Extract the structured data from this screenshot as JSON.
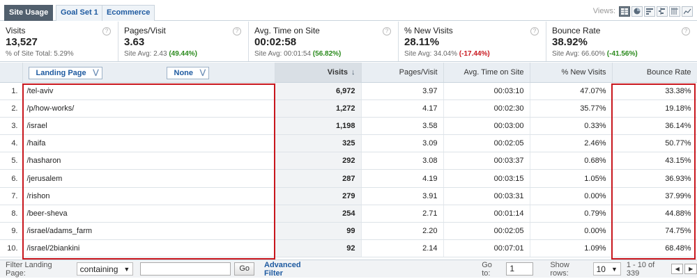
{
  "tabs": [
    {
      "label": "Site Usage",
      "active": true
    },
    {
      "label": "Goal Set 1",
      "active": false
    },
    {
      "label": "Ecommerce",
      "active": false
    }
  ],
  "views": {
    "label": "Views:",
    "icons": [
      "table-view-icon",
      "pie-view-icon",
      "performance-view-icon",
      "comparison-view-icon",
      "pivot-view-icon",
      "trend-view-icon"
    ]
  },
  "scorecard": [
    {
      "name": "Visits",
      "value": "13,527",
      "sub_prefix": "% of Site Total: ",
      "sub_value": "5.29%",
      "sub_delta": ""
    },
    {
      "name": "Pages/Visit",
      "value": "3.63",
      "sub_prefix": "Site Avg: ",
      "sub_value": "2.43",
      "sub_delta": "(49.44%)",
      "delta_type": "pos"
    },
    {
      "name": "Avg. Time on Site",
      "value": "00:02:58",
      "sub_prefix": "Site Avg: ",
      "sub_value": "00:01:54",
      "sub_delta": "(56.82%)",
      "delta_type": "pos"
    },
    {
      "name": "% New Visits",
      "value": "28.11%",
      "sub_prefix": "Site Avg: ",
      "sub_value": "34.04%",
      "sub_delta": "(-17.44%)",
      "delta_type": "neg"
    },
    {
      "name": "Bounce Rate",
      "value": "38.92%",
      "sub_prefix": "Site Avg: ",
      "sub_value": "66.60%",
      "sub_delta": "(-41.56%)",
      "delta_type": "pos"
    }
  ],
  "table": {
    "primary_dimension": "Landing Page",
    "secondary_dimension": "None",
    "columns": [
      "Visits",
      "Pages/Visit",
      "Avg. Time on Site",
      "% New Visits",
      "Bounce Rate"
    ],
    "rows": [
      {
        "idx": "1.",
        "page": "/tel-aviv",
        "visits": "6,972",
        "ppv": "3.97",
        "time": "00:03:10",
        "new": "47.07%",
        "bounce": "33.38%"
      },
      {
        "idx": "2.",
        "page": "/p/how-works/",
        "visits": "1,272",
        "ppv": "4.17",
        "time": "00:02:30",
        "new": "35.77%",
        "bounce": "19.18%"
      },
      {
        "idx": "3.",
        "page": "/israel",
        "visits": "1,198",
        "ppv": "3.58",
        "time": "00:03:00",
        "new": "0.33%",
        "bounce": "36.14%"
      },
      {
        "idx": "4.",
        "page": "/haifa",
        "visits": "325",
        "ppv": "3.09",
        "time": "00:02:05",
        "new": "2.46%",
        "bounce": "50.77%"
      },
      {
        "idx": "5.",
        "page": "/hasharon",
        "visits": "292",
        "ppv": "3.08",
        "time": "00:03:37",
        "new": "0.68%",
        "bounce": "43.15%"
      },
      {
        "idx": "6.",
        "page": "/jerusalem",
        "visits": "287",
        "ppv": "4.19",
        "time": "00:03:15",
        "new": "1.05%",
        "bounce": "36.93%"
      },
      {
        "idx": "7.",
        "page": "/rishon",
        "visits": "279",
        "ppv": "3.91",
        "time": "00:03:31",
        "new": "0.00%",
        "bounce": "37.99%"
      },
      {
        "idx": "8.",
        "page": "/beer-sheva",
        "visits": "254",
        "ppv": "2.71",
        "time": "00:01:14",
        "new": "0.79%",
        "bounce": "44.88%"
      },
      {
        "idx": "9.",
        "page": "/israel/adams_farm",
        "visits": "99",
        "ppv": "2.20",
        "time": "00:02:05",
        "new": "0.00%",
        "bounce": "74.75%"
      },
      {
        "idx": "10.",
        "page": "/israel/2biankini",
        "visits": "92",
        "ppv": "2.14",
        "time": "00:07:01",
        "new": "1.09%",
        "bounce": "68.48%"
      }
    ]
  },
  "footer": {
    "filter_label": "Filter Landing Page:",
    "filter_mode": "containing",
    "filter_value": "",
    "go_label": "Go",
    "advanced_filter_label": "Advanced Filter",
    "goto_label": "Go to:",
    "goto_value": "1",
    "show_rows_label": "Show rows:",
    "show_rows_value": "10",
    "range_text": "1 - 10 of 339"
  },
  "colors": {
    "highlight": "#c8161d",
    "positive": "#2a8a1c",
    "negative": "#c8161d",
    "tab_active": "#515f6d",
    "link": "#1e5aa0"
  }
}
